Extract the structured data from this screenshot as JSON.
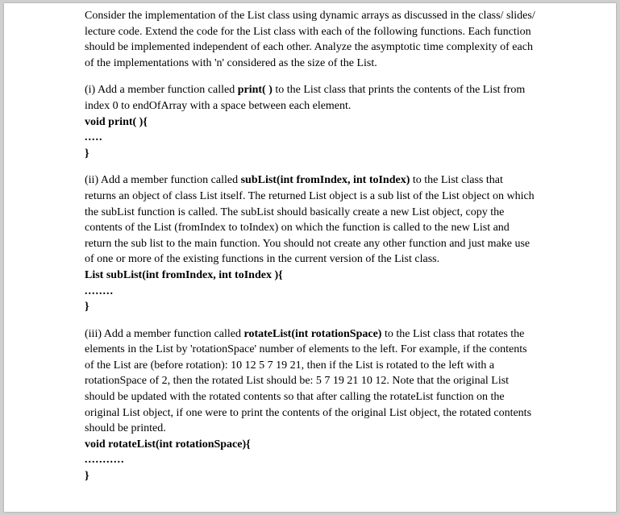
{
  "intro": "Consider the implementation of the List class using dynamic arrays as discussed in the class/ slides/ lecture code. Extend the code for the List class with each of the following functions. Each function should be implemented independent of each other. Analyze the asymptotic time complexity of each of the implementations with 'n' considered as the size of the List.",
  "q1": {
    "prefix": "(i) Add a member function called ",
    "func": "print( )",
    "suffix": " to the List class that prints the contents of the List from index 0 to endOfArray with a space between each element.",
    "sig": "void print( ){",
    "dots": ".....",
    "close": "}"
  },
  "q2": {
    "prefix": "(ii) Add a member function called ",
    "func": "subList(int fromIndex, int toIndex)",
    "suffix": " to the List class that returns an object of class List itself. The returned List object is a sub list of the List object on which the subList function is called. The subList should basically create a new List object, copy the contents of the List (fromIndex to toIndex) on which the function is called to the new List and return the sub list to the main function. You should not create any other function and just make use of one or more of the existing functions in the current version of the List class.",
    "sig": "List subList(int fromIndex, int toIndex ){",
    "dots": "........",
    "close": "}"
  },
  "q3": {
    "prefix": "(iii) Add a member function called ",
    "func": "rotateList(int rotationSpace)",
    "suffix": " to the List class that rotates the elements in the List by 'rotationSpace' number of elements to the left. For example, if the contents of the List are (before rotation): 10  12  5  7  19  21, then if the List is rotated to the left with a rotationSpace of 2, then the rotated List should be: 5  7  19  21  10  12. Note that the original List should be updated with the rotated contents so that after calling the rotateList function on the original List object, if one were to print the contents of the original List object, the rotated contents should be printed.",
    "sig": "void rotateList(int rotationSpace){",
    "dots": "...........",
    "close": "}"
  }
}
